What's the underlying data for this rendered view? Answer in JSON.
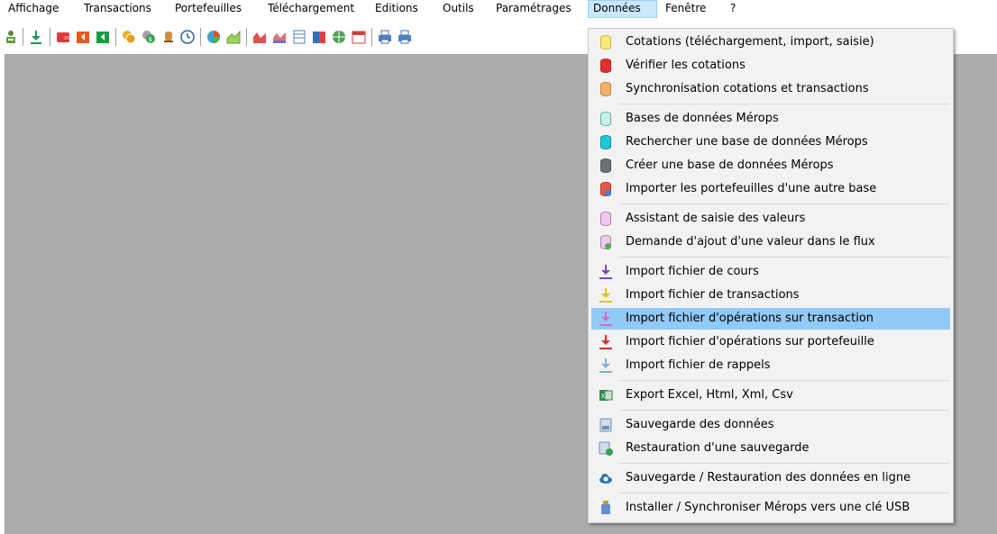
{
  "menubar": {
    "items": [
      {
        "label": "Affichage"
      },
      {
        "label": "Transactions"
      },
      {
        "label": "Portefeuilles"
      },
      {
        "label": "Téléchargement"
      },
      {
        "label": "Editions"
      },
      {
        "label": "Outils"
      },
      {
        "label": "Paramétrages"
      },
      {
        "label": "Données"
      },
      {
        "label": "Fenêtre"
      },
      {
        "label": "?"
      }
    ],
    "active": "Données"
  },
  "toolbar": {
    "icons": [
      "user-icon",
      "download-icon",
      "wallet-icon",
      "orange-wallet-icon",
      "green-wallet-icon",
      "coins-icon",
      "dollar-coins-icon",
      "bell-icon",
      "clock-icon",
      "pie-chart-icon",
      "area-chart-icon",
      "red-chart-icon",
      "line-chart-icon",
      "table-icon",
      "bar-chart-icon",
      "globe-icon",
      "calendar-icon",
      "print-icon",
      "print-preview-icon"
    ]
  },
  "menu": {
    "items": [
      {
        "label": "Cotations (téléchargement, import, saisie)",
        "icon": "yellow-database-icon"
      },
      {
        "label": "Vérifier les cotations",
        "icon": "red-database-icon"
      },
      {
        "label": "Synchronisation cotations et transactions",
        "icon": "orange-database-icon"
      },
      {
        "label": "Bases de données Mérops",
        "icon": "light-teal-database-icon"
      },
      {
        "label": "Rechercher une base de données Mérops",
        "icon": "cyan-database-icon"
      },
      {
        "label": "Créer une base de données Mérops",
        "icon": "gray-database-icon"
      },
      {
        "label": "Importer les portefeuilles d'une autre base",
        "icon": "import-database-icon"
      },
      {
        "label": "Assistant de saisie des valeurs",
        "icon": "pink-database-icon"
      },
      {
        "label": "Demande d'ajout d'une valeur dans le flux",
        "icon": "add-database-icon"
      },
      {
        "label": "Import fichier de cours",
        "icon": "purple-download-icon"
      },
      {
        "label": "Import fichier de transactions",
        "icon": "yellow-download-icon"
      },
      {
        "label": "Import fichier d'opérations sur transaction",
        "icon": "pink-download-icon"
      },
      {
        "label": "Import fichier d'opérations sur portefeuille",
        "icon": "red-download-icon"
      },
      {
        "label": "Import fichier de rappels",
        "icon": "blue-download-icon"
      },
      {
        "label": "Export Excel, Html, Xml, Csv",
        "icon": "excel-export-icon"
      },
      {
        "label": "Sauvegarde des données",
        "icon": "save-data-icon"
      },
      {
        "label": "Restauration d'une sauvegarde",
        "icon": "restore-backup-icon"
      },
      {
        "label": "Sauvegarde / Restauration des données en ligne",
        "icon": "cloud-backup-icon"
      },
      {
        "label": "Installer / Synchroniser Mérops vers une clé USB",
        "icon": "usb-key-icon"
      }
    ],
    "highlighted": "Import fichier d'opérations sur transaction"
  }
}
